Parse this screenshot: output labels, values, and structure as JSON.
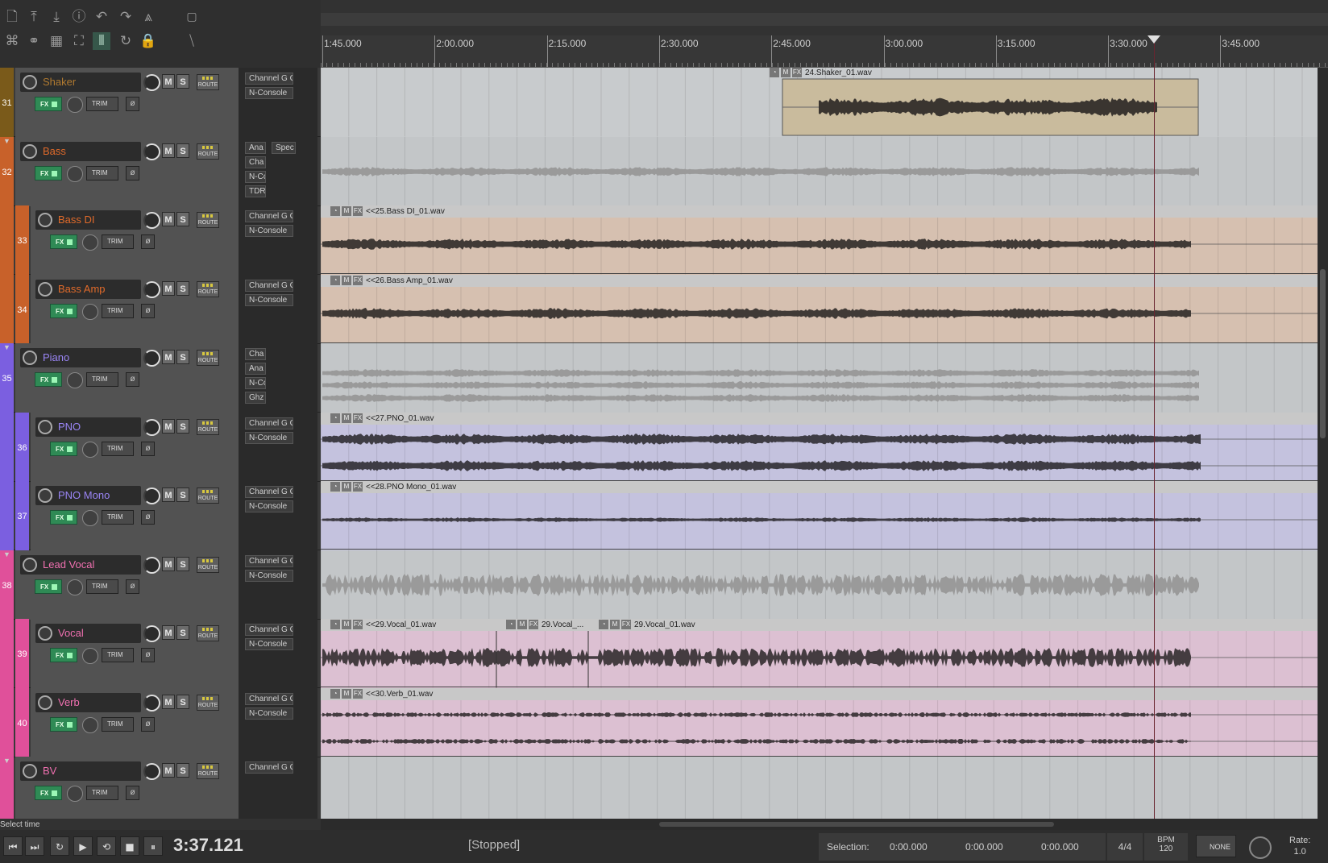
{
  "ruler": {
    "labels": [
      "1:45.000",
      "2:00.000",
      "2:15.000",
      "2:30.000",
      "2:45.000",
      "3:00.000",
      "3:15.000",
      "3:30.000",
      "3:45.000"
    ]
  },
  "tracks": [
    {
      "num": "31",
      "name": "Shaker",
      "color": "#7a5a1a",
      "name_color": "#b07a30",
      "depth": 0,
      "folder": false,
      "fx": [
        "Channel G C",
        "N-Console"
      ],
      "lane": "#c8cbcd",
      "item": "24.Shaker_01.wav",
      "wave": "#3a3530"
    },
    {
      "num": "32",
      "name": "Bass",
      "color": "#c8612a",
      "name_color": "#e06a2a",
      "depth": 0,
      "folder": true,
      "fx": [
        "Ana",
        "Cha",
        "N-Cc",
        "TDR"
      ],
      "fx_extra": "Spec",
      "lane": "#c3c6c8",
      "item": "",
      "wave": "#9a9a9a"
    },
    {
      "num": "33",
      "name": "Bass DI",
      "color": "#c8612a",
      "name_color": "#e06a2a",
      "depth": 1,
      "folder": false,
      "fx": [
        "Channel G C",
        "N-Console"
      ],
      "lane": "#d6c0b0",
      "item": "<<25.Bass DI_01.wav",
      "wave": "#403a36"
    },
    {
      "num": "34",
      "name": "Bass Amp",
      "color": "#c8612a",
      "name_color": "#e06a2a",
      "depth": 1,
      "folder": false,
      "fx": [
        "Channel G C",
        "N-Console"
      ],
      "lane": "#d6c0b0",
      "item": "<<26.Bass Amp_01.wav",
      "wave": "#403a36"
    },
    {
      "num": "35",
      "name": "Piano",
      "color": "#7b5fe0",
      "name_color": "#9a85f5",
      "depth": 0,
      "folder": true,
      "fx": [
        "Cha",
        "Ana",
        "N-Cc",
        "Ghz"
      ],
      "lane": "#c3c6c8",
      "item": "",
      "wave": "#9a9a9a"
    },
    {
      "num": "36",
      "name": "PNO",
      "color": "#7b5fe0",
      "name_color": "#9a85f5",
      "depth": 1,
      "folder": false,
      "fx": [
        "Channel G C",
        "N-Console"
      ],
      "lane": "#c4c2de",
      "item": "<<27.PNO_01.wav",
      "wave": "#3e3c44"
    },
    {
      "num": "37",
      "name": "PNO Mono",
      "color": "#7b5fe0",
      "name_color": "#9a85f5",
      "depth": 1,
      "folder": false,
      "fx": [
        "Channel G C",
        "N-Console"
      ],
      "lane": "#c4c2de",
      "item": "<<28.PNO Mono_01.wav",
      "wave": "#3e3c44"
    },
    {
      "num": "38",
      "name": "Lead Vocal",
      "color": "#e0509a",
      "name_color": "#f070b0",
      "depth": 0,
      "folder": true,
      "fx": [
        "Channel G C",
        "N-Console"
      ],
      "lane": "#c3c6c8",
      "item": "",
      "wave": "#9a9a9a"
    },
    {
      "num": "39",
      "name": "Vocal",
      "color": "#e0509a",
      "name_color": "#f070b0",
      "depth": 1,
      "folder": false,
      "fx": [
        "Channel G C",
        "N-Console"
      ],
      "lane": "#dcc0d2",
      "item": "<<29.Vocal_01.wav",
      "item2": "29.Vocal_...",
      "item3": "29.Vocal_01.wav",
      "wave": "#443c40"
    },
    {
      "num": "40",
      "name": "Verb",
      "color": "#e0509a",
      "name_color": "#f070b0",
      "depth": 1,
      "folder": false,
      "fx": [
        "Channel G C",
        "N-Console"
      ],
      "lane": "#dcc0d2",
      "item": "<<30.Verb_01.wav",
      "wave": "#443c40"
    },
    {
      "num": "",
      "name": "BV",
      "color": "#e0509a",
      "name_color": "#f070b0",
      "depth": 0,
      "folder": true,
      "fx": [
        "Channel G C"
      ],
      "lane": "#c3c6c8",
      "item": "",
      "wave": "#9a9a9a"
    }
  ],
  "buttons": {
    "fx": "FX",
    "trim": "TRIM",
    "route": "ROUTE",
    "m": "M",
    "s": "S",
    "phase": "ø"
  },
  "transport": {
    "time": "3:37.121",
    "status": "[Stopped]",
    "hint": "Select time",
    "selection_label": "Selection:",
    "sel_start": "0:00.000",
    "sel_end": "0:00.000",
    "sel_len": "0:00.000",
    "time_sig": "4/4",
    "bpm_label": "BPM",
    "bpm": "120",
    "snap": "NONE",
    "rate_label": "Rate:",
    "rate": "1.0"
  },
  "icons": {
    "toolbar_row1": [
      "new-project-icon",
      "save-icon",
      "render-icon",
      "info-icon",
      "undo-icon",
      "redo-icon",
      "metronome-icon",
      "grid-snap-icon"
    ],
    "toolbar_row2": [
      "ripple-icon",
      "link-icon",
      "grid-icon",
      "envelope-icon",
      "grid-lines-icon",
      "loop-icon",
      "lock-icon",
      "cursor-icon"
    ]
  }
}
